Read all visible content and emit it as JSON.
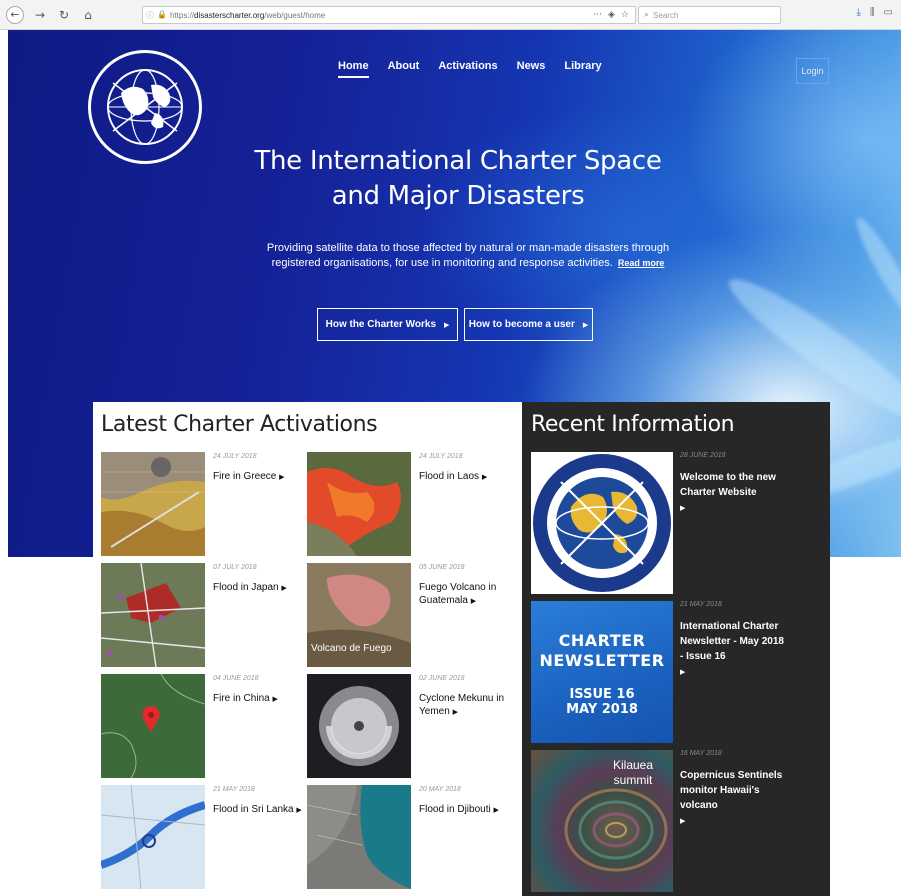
{
  "browser": {
    "url_prefix": "https://",
    "url_domain": "disasterscharter.org",
    "url_path": "/web/guest/home",
    "search_placeholder": "Search"
  },
  "nav": {
    "items": [
      {
        "label": "Home",
        "active": true
      },
      {
        "label": "About"
      },
      {
        "label": "Activations"
      },
      {
        "label": "News"
      },
      {
        "label": "Library"
      }
    ],
    "login": "Login"
  },
  "hero": {
    "title_line1": "The International Charter Space",
    "title_line2": "and Major Disasters",
    "tagline_line1": "Providing satellite data to those affected by natural or man-made disasters through",
    "tagline_line2": "registered organisations, for use in monitoring and response activities.",
    "read_more": "Read more",
    "btn_works": "How the Charter Works",
    "btn_user": "How to become a user"
  },
  "activations": {
    "heading": "Latest Charter Activations",
    "items": [
      {
        "date": "24 JULY 2018",
        "title": "Fire in Greece"
      },
      {
        "date": "24 JULY 2018",
        "title": "Flood in Laos"
      },
      {
        "date": "07 JULY 2018",
        "title": "Flood in Japan"
      },
      {
        "date": "05 JUNE 2018",
        "title": "Fuego Volcano in Guatemala",
        "image_caption": "Volcano de Fuego"
      },
      {
        "date": "04 JUNE 2018",
        "title": "Fire in China"
      },
      {
        "date": "02 JUNE 2018",
        "title": "Cyclone Mekunu in Yemen"
      },
      {
        "date": "21 MAY 2018",
        "title": "Flood in Sri Lanka"
      },
      {
        "date": "20 MAY 2018",
        "title": "Flood in Djibouti"
      }
    ]
  },
  "recent": {
    "heading": "Recent Information",
    "items": [
      {
        "date": "28 JUNE 2018",
        "title": "Welcome to the new Charter Website"
      },
      {
        "date": "21 MAY 2018",
        "title": "International Charter Newsletter - May 2018 - Issue 16",
        "img_line1": "CHARTER",
        "img_line2": "NEWSLETTER",
        "img_line3": "ISSUE 16",
        "img_line4": "MAY 2018"
      },
      {
        "date": "16 MAY 2018",
        "title": "Copernicus Sentinels monitor Hawaii's volcano",
        "img_label": "Kilauea summit"
      }
    ]
  },
  "arrow_glyph": "▶",
  "colors": {
    "hero_dark": "#0f1a86",
    "panel_dark": "#272727",
    "login_border": "#6aa0ff"
  }
}
